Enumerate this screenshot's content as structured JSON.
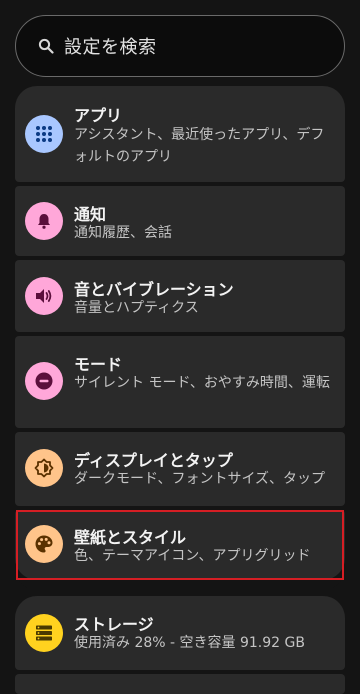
{
  "search": {
    "placeholder": "設定を検索",
    "icon": "search-icon"
  },
  "settings": [
    {
      "key": "apps",
      "title": "アプリ",
      "subtitle": "アシスタント、最近使ったアプリ、デフォルトのアプリ",
      "icon": "apps-grid-icon",
      "icon_bg": "#a9c7ff",
      "icon_fg": "#0b3a84"
    },
    {
      "key": "notifications",
      "title": "通知",
      "subtitle": "通知履歴、会話",
      "icon": "bell-icon",
      "icon_bg": "#ffa7d9",
      "icon_fg": "#5b0f3c"
    },
    {
      "key": "sound",
      "title": "音とバイブレーション",
      "subtitle": "音量とハプティクス",
      "icon": "volume-icon",
      "icon_bg": "#ffa7d9",
      "icon_fg": "#5b0f3c"
    },
    {
      "key": "modes",
      "title": "モード",
      "subtitle": "サイレント モード、おやすみ時間、運転",
      "icon": "do-not-disturb-icon",
      "icon_bg": "#ffa7d9",
      "icon_fg": "#5b0f3c"
    },
    {
      "key": "display",
      "title": "ディスプレイとタップ",
      "subtitle": "ダークモード、フォントサイズ、タップ",
      "icon": "brightness-icon",
      "icon_bg": "#ffc48a",
      "icon_fg": "#5a3100"
    },
    {
      "key": "wallpaper",
      "title": "壁紙とスタイル",
      "subtitle": "色、テーマアイコン、アプリグリッド",
      "icon": "palette-icon",
      "icon_bg": "#ffc48a",
      "icon_fg": "#5a3100"
    },
    {
      "key": "storage",
      "title": "ストレージ",
      "subtitle": "使用済み 28% - 空き容量 91.92 GB",
      "icon": "storage-icon",
      "icon_bg": "#ffd21f",
      "icon_fg": "#4a3a00"
    }
  ],
  "colors": {
    "background": "#141414",
    "card": "#2a2a2a",
    "highlight_border": "#d51e24"
  }
}
